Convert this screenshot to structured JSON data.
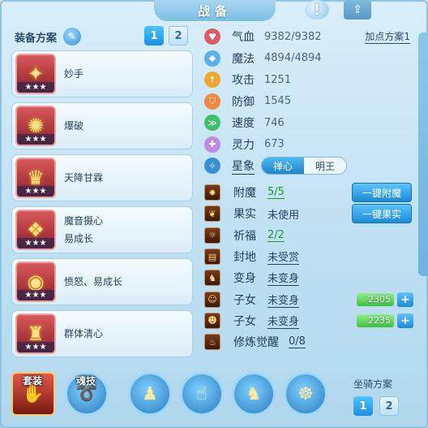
{
  "title": "战备",
  "header": {
    "info_icon": "exclamation-icon",
    "share_icon": "share-icon"
  },
  "equip": {
    "header_label": "装备方案",
    "plans": [
      "1",
      "2"
    ],
    "active_plan": "1",
    "items": [
      {
        "line1": "妙手",
        "line2": "",
        "stars": "★★★",
        "glyph": "✦"
      },
      {
        "line1": "爆破",
        "line2": "",
        "stars": "★★★",
        "glyph": "✺"
      },
      {
        "line1": "天降甘霖",
        "line2": "",
        "stars": "★★★",
        "glyph": "♛"
      },
      {
        "line1": "魔音摄心",
        "line2": "易成长",
        "stars": "★★★",
        "glyph": "❖"
      },
      {
        "line1": "愤怒、易成长",
        "line2": "",
        "stars": "★★★",
        "glyph": "◉"
      },
      {
        "line1": "群体清心",
        "line2": "",
        "stars": "★★★",
        "glyph": "♜"
      }
    ]
  },
  "stats": {
    "addpoint_label": "加点方案1",
    "rows": [
      {
        "label": "气血",
        "value": "9382/9382",
        "color": "#e05a6a",
        "icon": "heart-icon",
        "glyph": "♥"
      },
      {
        "label": "魔法",
        "value": "4894/4894",
        "color": "#5ab0e8",
        "icon": "diamond-icon",
        "glyph": "◆"
      },
      {
        "label": "攻击",
        "value": "1251",
        "color": "#f0a830",
        "icon": "sword-icon",
        "glyph": "↑"
      },
      {
        "label": "防御",
        "value": "1545",
        "color": "#f08a40",
        "icon": "shield-icon",
        "glyph": "⛉"
      },
      {
        "label": "速度",
        "value": "746",
        "color": "#3fbf6a",
        "icon": "speed-icon",
        "glyph": "≫"
      },
      {
        "label": "灵力",
        "value": "673",
        "color": "#c08ae0",
        "icon": "spirit-icon",
        "glyph": "✚"
      }
    ],
    "star_label": "星象",
    "star_toggle": [
      "禅心",
      "明王"
    ],
    "star_active": "禅心"
  },
  "features": [
    {
      "label": "附魔",
      "value": "5/5",
      "style": "green",
      "action": "一键附魔",
      "icon": "enchant-icon",
      "glyph": "✸"
    },
    {
      "label": "果实",
      "value": "未使用",
      "style": "plain",
      "action": "一键果实",
      "icon": "fruit-icon",
      "glyph": "❦"
    },
    {
      "label": "祈福",
      "value": "2/2",
      "style": "green",
      "action": "",
      "icon": "bless-icon",
      "glyph": "☼"
    },
    {
      "label": "封地",
      "value": "未受赏",
      "style": "ul",
      "action": "",
      "icon": "fief-icon",
      "glyph": "▤"
    },
    {
      "label": "变身",
      "value": "未变身",
      "style": "ul",
      "action": "",
      "icon": "transform-icon",
      "glyph": "♞"
    },
    {
      "label": "子女",
      "value": "未变身",
      "style": "ul",
      "bar": "2305",
      "icon": "child-icon",
      "glyph": "☺"
    },
    {
      "label": "子女",
      "value": "未变身",
      "style": "ul",
      "bar": "2235",
      "icon": "child-icon",
      "glyph": "☻"
    },
    {
      "label": "修炼觉醒",
      "value": "0/8",
      "style": "ul",
      "action": "",
      "icon": "cultivate-icon",
      "glyph": "♨"
    }
  ],
  "bottom": {
    "suit_label": "套装",
    "skill_label": "魂技",
    "mount_label": "坐骑方案",
    "mount_plans": [
      "1",
      "2"
    ],
    "mount_active": "1"
  }
}
